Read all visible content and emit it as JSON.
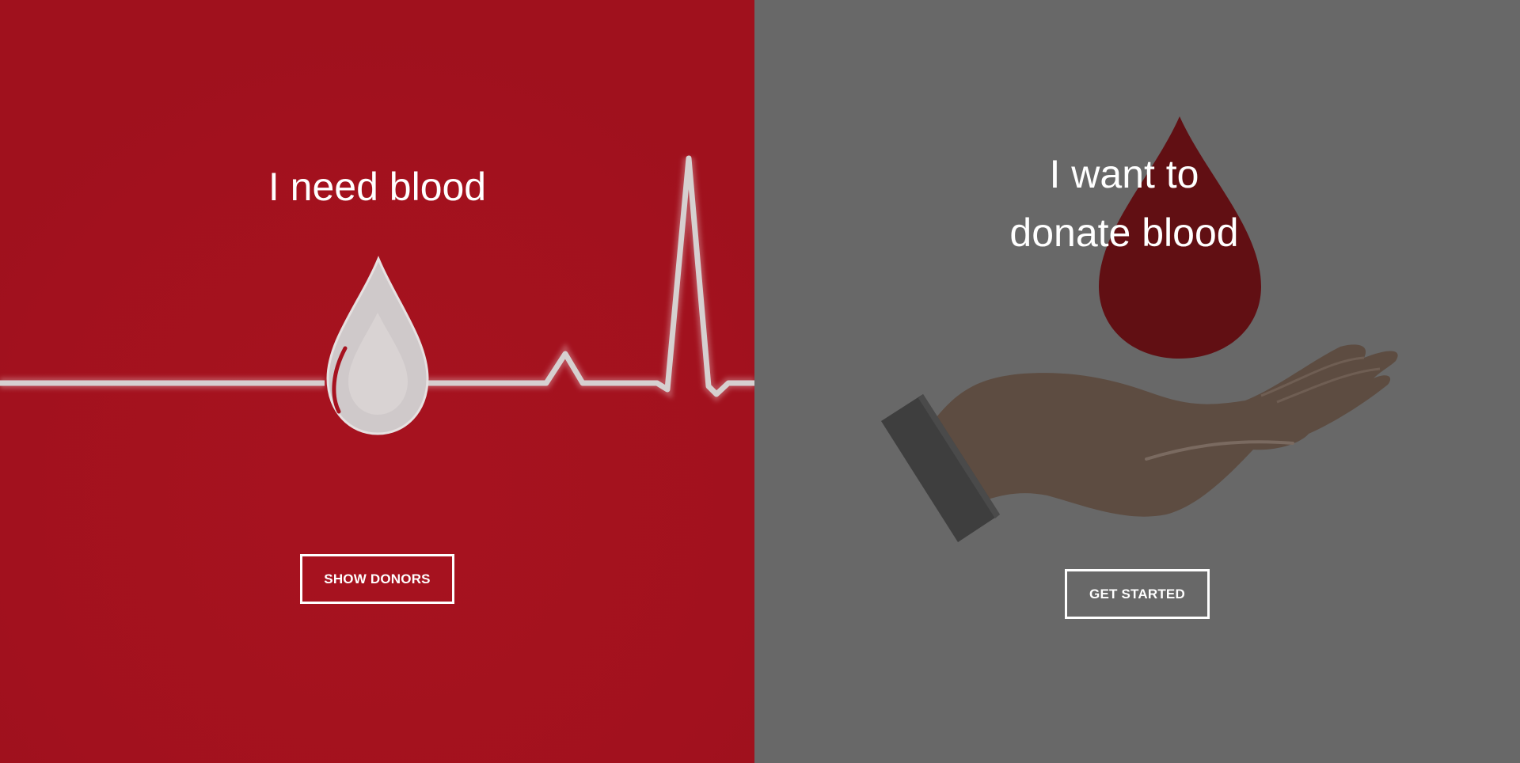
{
  "need_panel": {
    "title": "I need blood",
    "button_label": "SHOW DONORS",
    "background_color": "#a6121f",
    "illustration": "heartbeat-blood-drop"
  },
  "donate_panel": {
    "title_line1": "I want to",
    "title_line2": "donate blood",
    "button_label": "GET STARTED",
    "background_color": "#686868",
    "illustration": "hand-holding-blood-drop"
  }
}
